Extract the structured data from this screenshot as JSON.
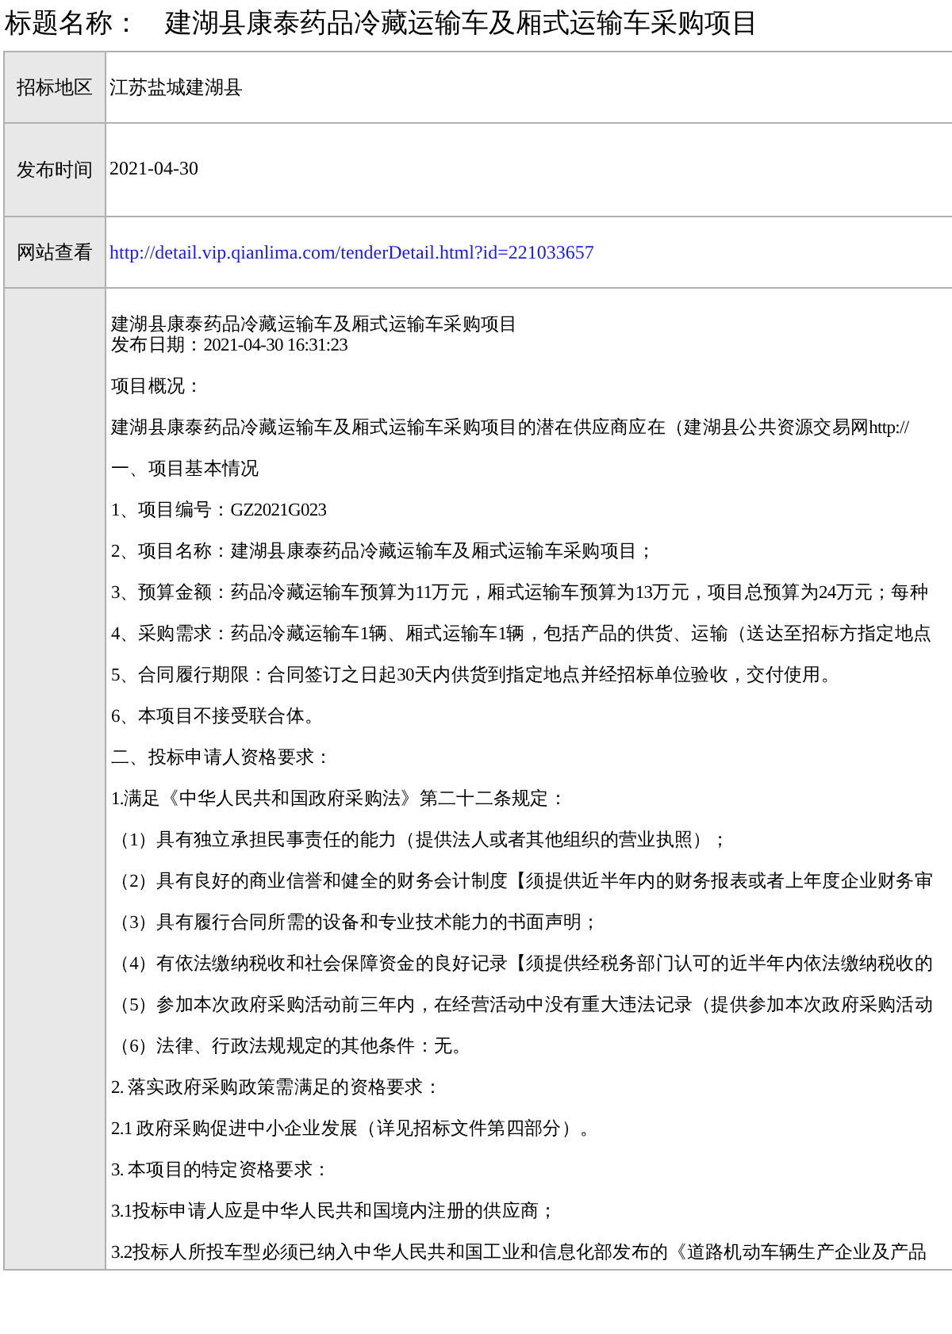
{
  "title": {
    "label": "标题名称：",
    "value": "建湖县康泰药品冷藏运输车及厢式运输车采购项目"
  },
  "fields": [
    {
      "label": "招标地区",
      "value": "江苏盐城建湖县",
      "kind": "text"
    },
    {
      "label": "发布时间",
      "value": "2021-04-30",
      "kind": "text"
    },
    {
      "label": "网站查看",
      "value": "http://detail.vip.qianlima.com/tenderDetail.html?id=221033657",
      "kind": "link"
    }
  ],
  "content": {
    "heading": [
      "建湖县康泰药品冷藏运输车及厢式运输车采购项目",
      "发布日期：2021-04-30 16:31:23"
    ],
    "paragraphs": [
      "项目概况：",
      "建湖县康泰药品冷藏运输车及厢式运输车采购项目的潜在供应商应在（建湖县公共资源交易网http://",
      "一、项目基本情况",
      "1、项目编号：GZ2021G023",
      "2、项目名称：建湖县康泰药品冷藏运输车及厢式运输车采购项目；",
      "3、预算金额：药品冷藏运输车预算为11万元，厢式运输车预算为13万元，项目总预算为24万元；每种",
      "4、采购需求：药品冷藏运输车1辆、厢式运输车1辆，包括产品的供货、运输（送达至招标方指定地点",
      "5、合同履行期限：合同签订之日起30天内供货到指定地点并经招标单位验收，交付使用。",
      "6、本项目不接受联合体。",
      "二、投标申请人资格要求：",
      "1.满足《中华人民共和国政府采购法》第二十二条规定：",
      "（1）具有独立承担民事责任的能力（提供法人或者其他组织的营业执照）；",
      "（2）具有良好的商业信誉和健全的财务会计制度【须提供近半年内的财务报表或者上年度企业财务审",
      "（3）具有履行合同所需的设备和专业技术能力的书面声明；",
      "（4）有依法缴纳税收和社会保障资金的良好记录【须提供经税务部门认可的近半年内依法缴纳税收的",
      "（5）参加本次政府采购活动前三年内，在经营活动中没有重大违法记录（提供参加本次政府采购活动",
      "（6）法律、行政法规规定的其他条件：无。",
      "2.  落实政府采购政策需满足的资格要求：",
      "2.1 政府采购促进中小企业发展（详见招标文件第四部分）。",
      "3.  本项目的特定资格要求：",
      "3.1投标申请人应是中华人民共和国境内注册的供应商；",
      "3.2投标人所投车型必须已纳入中华人民共和国工业和信息化部发布的《道路机动车辆生产企业及产品"
    ]
  }
}
